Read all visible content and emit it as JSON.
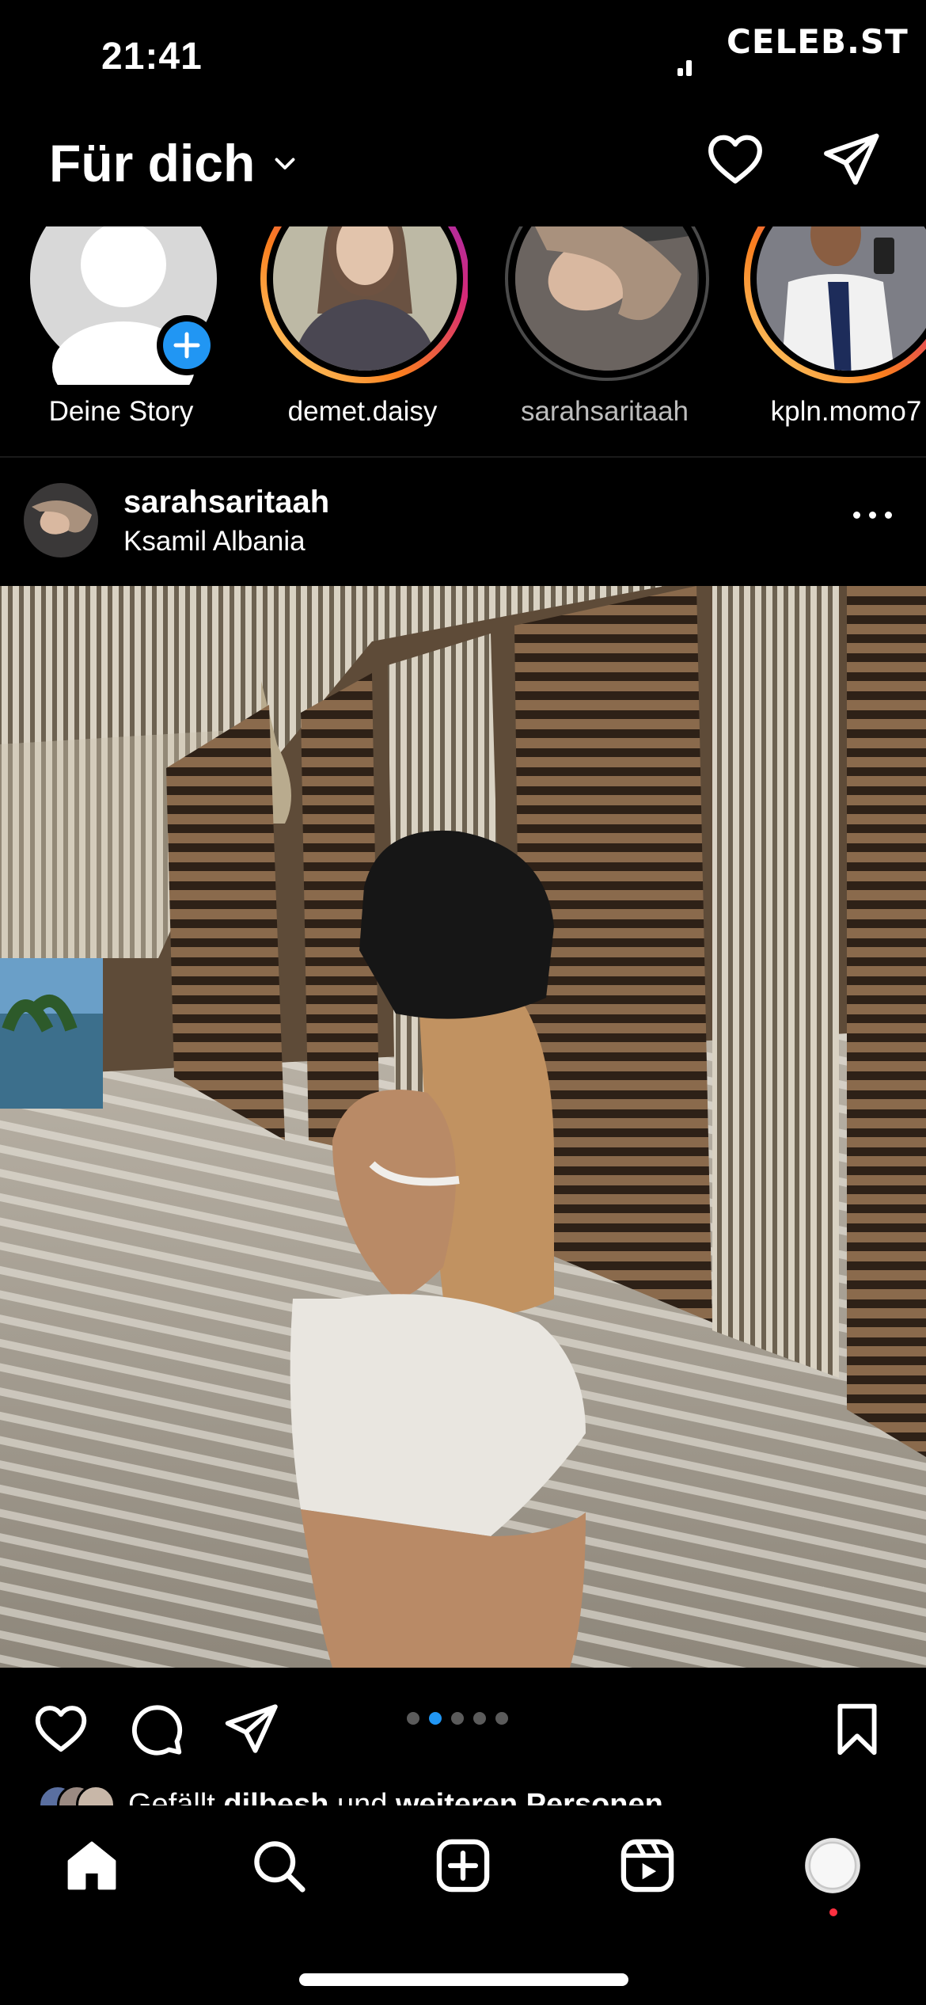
{
  "status_bar": {
    "time": "21:41"
  },
  "watermark": "CELEB.ST",
  "header": {
    "title": "Für dich",
    "icons": [
      "chevron-down-icon",
      "heart-icon",
      "direct-message-icon"
    ]
  },
  "stories": [
    {
      "label": "Deine Story",
      "kind": "own"
    },
    {
      "label": "demet.daisy",
      "kind": "unseen"
    },
    {
      "label": "sarahsaritaah",
      "kind": "seen"
    },
    {
      "label": "kpln.momo7",
      "kind": "unseen"
    }
  ],
  "post": {
    "username": "sarahsaritaah",
    "location": "Ksamil Albania",
    "carousel": {
      "count": 5,
      "active": 2
    },
    "likes_prefix": "Gefällt ",
    "likes_user": "dilbesh",
    "likes_middle": " und ",
    "likes_others": "weiteren Personen"
  },
  "nav": {
    "items": [
      "home-icon",
      "search-icon",
      "create-icon",
      "reels-icon",
      "profile-avatar"
    ]
  },
  "colors": {
    "background": "#000000",
    "story_gradient": [
      "#feda75",
      "#fa7e1e",
      "#d62976",
      "#962fbf"
    ],
    "carousel_active": "#2196f3",
    "notification_dot": "#ff3040",
    "add_story_badge": "#2196f3"
  }
}
